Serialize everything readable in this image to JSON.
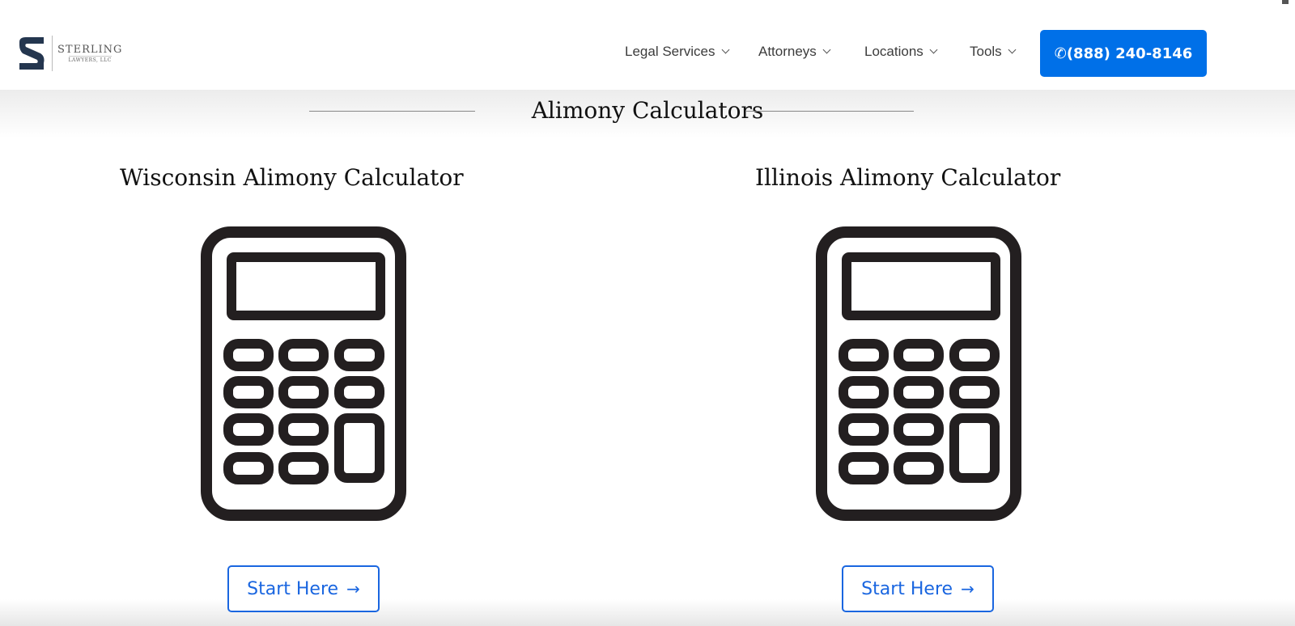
{
  "brand": {
    "name": "Sterling",
    "subtitle": "Lawyers, LLC"
  },
  "nav": {
    "items": [
      {
        "label": "Legal Services"
      },
      {
        "label": "Attorneys"
      },
      {
        "label": "Locations"
      },
      {
        "label": "Tools"
      }
    ],
    "phone": "(888) 240-8146"
  },
  "section": {
    "title": "Alimony Calculators"
  },
  "calculators": [
    {
      "title": "Wisconsin Alimony Calculator",
      "button": "Start Here",
      "icon": "calculator-icon"
    },
    {
      "title": "Illinois Alimony Calculator",
      "button": "Start Here",
      "icon": "calculator-icon"
    }
  ],
  "colors": {
    "accent": "#0070e8",
    "link": "#1a66e0"
  }
}
